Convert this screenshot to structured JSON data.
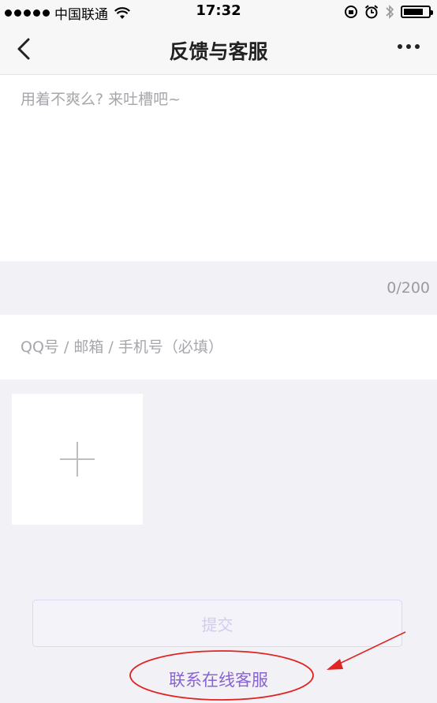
{
  "status_bar": {
    "carrier": "中国联通",
    "time": "17:32"
  },
  "nav": {
    "title": "反馈与客服"
  },
  "feedback": {
    "placeholder": "用着不爽么? 来吐槽吧~",
    "counter": "0/200"
  },
  "contact": {
    "placeholder": "QQ号 / 邮箱 / 手机号（必填）"
  },
  "actions": {
    "submit_label": "提交",
    "service_label": "联系在线客服"
  },
  "colors": {
    "accent": "#8a63d2",
    "annotation": "#e02424",
    "background": "#f2f1f6"
  }
}
